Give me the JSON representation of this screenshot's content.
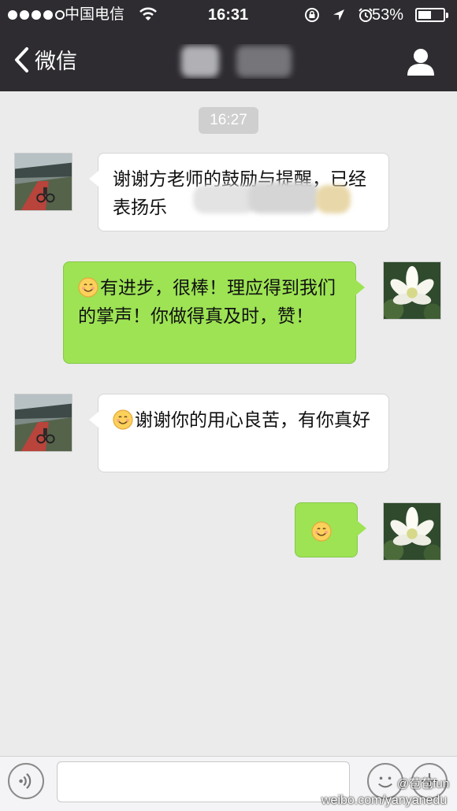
{
  "status_bar": {
    "carrier": "中国电信",
    "time": "16:31",
    "battery_percent": "53%",
    "battery_level": 0.53
  },
  "nav": {
    "back_label": "微信",
    "back_icon": "chevron-left-icon",
    "profile_icon": "person-icon"
  },
  "chat": {
    "timestamp": "16:27",
    "messages": [
      {
        "side": "in",
        "text": "谢谢方老师的鼓励与提醒，已经表扬乐",
        "emoji": false
      },
      {
        "side": "out",
        "text": "有进步，很棒！理应得到我们的掌声！你做得真及时，赞！",
        "emoji": true
      },
      {
        "side": "in",
        "text": "谢谢你的用心良苦，有你真好",
        "emoji": true
      },
      {
        "side": "out",
        "text": "",
        "emoji": true
      }
    ]
  },
  "input_bar": {
    "voice_icon": "voice-icon",
    "emoji_icon": "emoji-icon",
    "plus_icon": "plus-icon",
    "placeholder": ""
  },
  "watermark": {
    "account": "@苞苞fun",
    "url": "weibo.com/yanyanedu"
  },
  "colors": {
    "nav_bg": "#2e2c31",
    "chat_bg": "#ebebeb",
    "outgoing_bubble": "#9de354",
    "incoming_bubble": "#ffffff"
  }
}
